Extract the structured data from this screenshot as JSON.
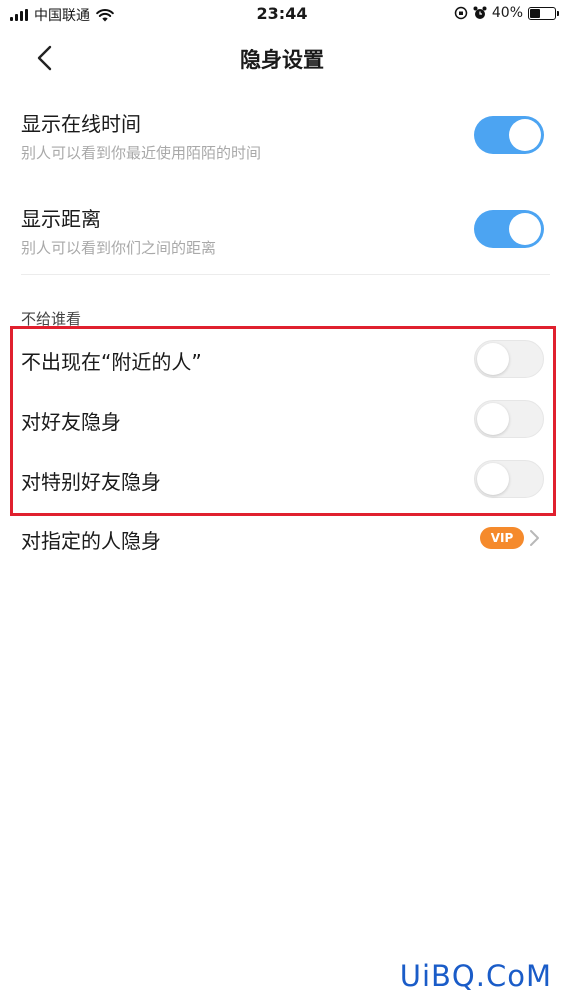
{
  "status_bar": {
    "carrier": "中国联通",
    "time": "23:44",
    "battery": "40%",
    "battery_level": 0.4
  },
  "nav": {
    "title": "隐身设置",
    "back_icon": "chevron-left-icon"
  },
  "settings": {
    "online_time": {
      "title": "显示在线时间",
      "subtitle": "别人可以看到你最近使用陌陌的时间",
      "on": true
    },
    "distance": {
      "title": "显示距离",
      "subtitle": "别人可以看到你们之间的距离",
      "on": true
    }
  },
  "hide_from": {
    "section_label": "不给谁看",
    "items": [
      {
        "title": "不出现在“附近的人”",
        "on": false
      },
      {
        "title": "对好友隐身",
        "on": false
      },
      {
        "title": "对特别好友隐身",
        "on": false
      }
    ],
    "specific": {
      "title": "对指定的人隐身",
      "badge": "VIP"
    }
  },
  "colors": {
    "toggle_on": "#4ca4f2",
    "highlight": "#e0202e",
    "vip": "#f58a2c"
  },
  "watermark": "UiBQ.CoM"
}
